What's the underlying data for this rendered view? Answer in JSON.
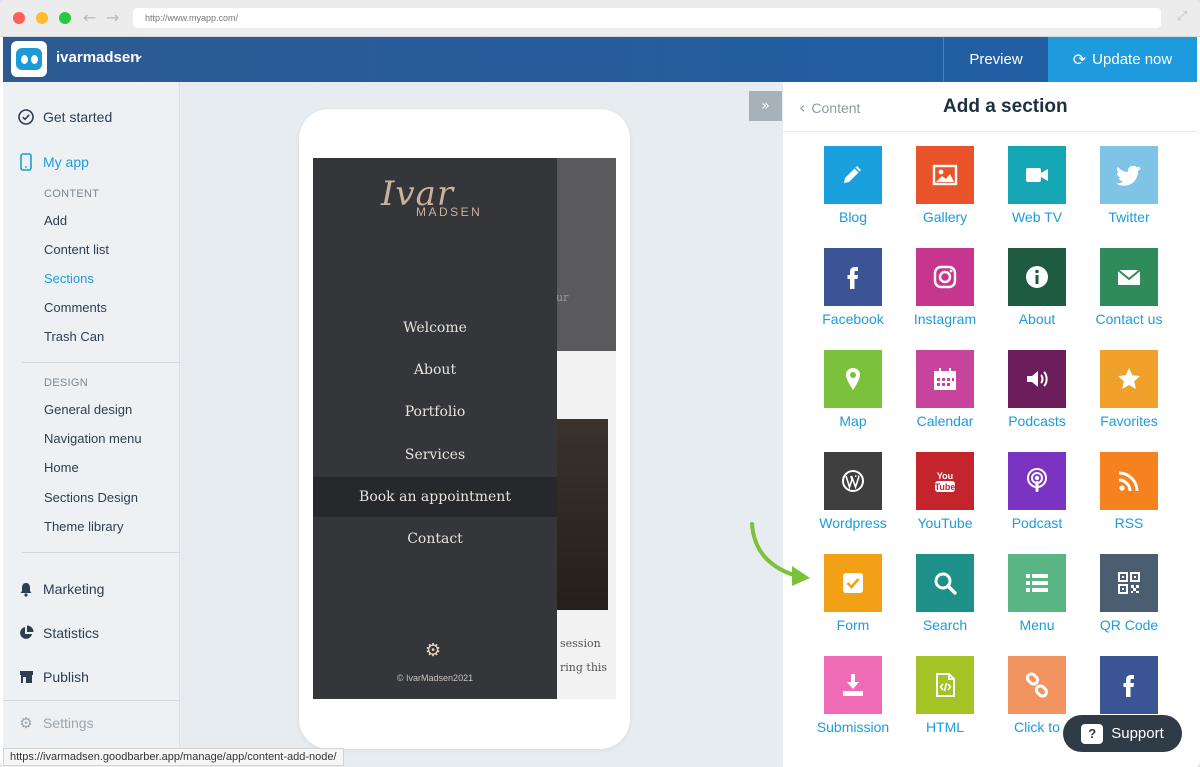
{
  "browser": {
    "url": "http://www.myapp.com/",
    "status_url": "https://ivarmadsen.goodbarber.app/manage/app/content-add-node/"
  },
  "header": {
    "username": "ivarmadsen",
    "preview_label": "Preview",
    "update_label": "Update now"
  },
  "sidebar": {
    "get_started": "Get started",
    "my_app": "My app",
    "content_head": "CONTENT",
    "content_items": [
      "Add",
      "Content list",
      "Sections",
      "Comments",
      "Trash Can"
    ],
    "design_head": "DESIGN",
    "design_items": [
      "General design",
      "Navigation menu",
      "Home",
      "Sections Design",
      "Theme library"
    ],
    "marketing": "Marketing",
    "statistics": "Statistics",
    "publish": "Publish",
    "settings": "Settings"
  },
  "phone": {
    "logo_script": "Ivar",
    "logo_sub": "MADSEN",
    "menu": [
      "Welcome",
      "About",
      "Portfolio",
      "Services",
      "Book an appointment",
      "Contact"
    ],
    "copyright": "© IvarMadsen2021",
    "bg_texts": [
      "ur",
      "session",
      "ring this"
    ]
  },
  "panel": {
    "back_label": "Content",
    "title": "Add a section",
    "tiles": [
      {
        "label": "Blog",
        "icon": "pencil-icon",
        "color": "#1ba0de"
      },
      {
        "label": "Gallery",
        "icon": "image-icon",
        "color": "#e9532a"
      },
      {
        "label": "Web TV",
        "icon": "video-camera-icon",
        "color": "#14a6b2"
      },
      {
        "label": "Twitter",
        "icon": "twitter-icon",
        "color": "#7fc4e7"
      },
      {
        "label": "Facebook",
        "icon": "facebook-icon",
        "color": "#3b5493"
      },
      {
        "label": "Instagram",
        "icon": "instagram-icon",
        "color": "#c6368e"
      },
      {
        "label": "About",
        "icon": "info-icon",
        "color": "#1d5a3f"
      },
      {
        "label": "Contact us",
        "icon": "envelope-icon",
        "color": "#2f8a5c"
      },
      {
        "label": "Map",
        "icon": "map-pin-icon",
        "color": "#7cc13b"
      },
      {
        "label": "Calendar",
        "icon": "calendar-icon",
        "color": "#c7449c"
      },
      {
        "label": "Podcasts",
        "icon": "speaker-icon",
        "color": "#6b1e5b"
      },
      {
        "label": "Favorites",
        "icon": "star-icon",
        "color": "#f0a129"
      },
      {
        "label": "Wordpress",
        "icon": "wordpress-icon",
        "color": "#3f3f3f"
      },
      {
        "label": "YouTube",
        "icon": "youtube-icon",
        "color": "#c4242c"
      },
      {
        "label": "Podcast",
        "icon": "podcast-icon",
        "color": "#7b34c2"
      },
      {
        "label": "RSS",
        "icon": "rss-icon",
        "color": "#f5811f"
      },
      {
        "label": "Form",
        "icon": "checkbox-icon",
        "color": "#f2a116"
      },
      {
        "label": "Search",
        "icon": "search-icon",
        "color": "#1d9188"
      },
      {
        "label": "Menu",
        "icon": "list-icon",
        "color": "#5ab584"
      },
      {
        "label": "QR Code",
        "icon": "qr-code-icon",
        "color": "#4b5d70"
      },
      {
        "label": "Submission",
        "icon": "download-icon",
        "color": "#f06bb5"
      },
      {
        "label": "HTML",
        "icon": "html-icon",
        "color": "#a4c426"
      },
      {
        "label": "Click to",
        "icon": "link-icon",
        "color": "#f29460"
      },
      {
        "label": "",
        "icon": "facebook-icon",
        "color": "#3b5493"
      }
    ]
  },
  "support": {
    "label": "Support"
  }
}
